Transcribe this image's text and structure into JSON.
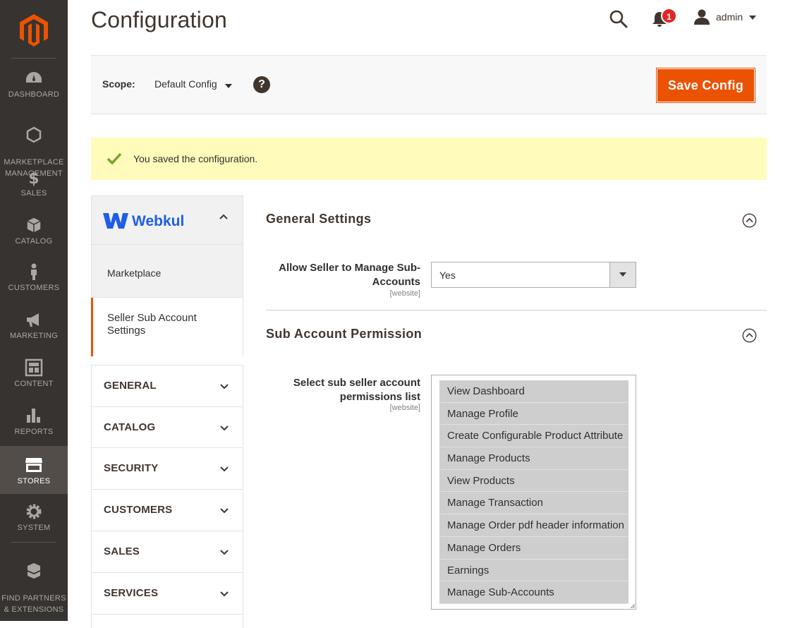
{
  "nav": {
    "items": [
      {
        "label": "DASHBOARD",
        "icon": "dashboard-icon"
      },
      {
        "label": "MARKETPLACE\nMANAGEMENT",
        "icon": "hexagon-icon"
      },
      {
        "label": "SALES",
        "icon": "dollar-icon"
      },
      {
        "label": "CATALOG",
        "icon": "box-icon"
      },
      {
        "label": "CUSTOMERS",
        "icon": "person-icon"
      },
      {
        "label": "MARKETING",
        "icon": "megaphone-icon"
      },
      {
        "label": "CONTENT",
        "icon": "layout-icon"
      },
      {
        "label": "REPORTS",
        "icon": "bar-chart-icon"
      },
      {
        "label": "STORES",
        "icon": "storefront-icon",
        "active": true
      },
      {
        "label": "SYSTEM",
        "icon": "gear-icon"
      },
      {
        "label": "FIND PARTNERS\n& EXTENSIONS",
        "icon": "boxes-icon"
      }
    ]
  },
  "header": {
    "title": "Configuration",
    "notification_count": "1",
    "username": "admin"
  },
  "scope": {
    "label": "Scope:",
    "value": "Default Config",
    "help": "?",
    "save_label": "Save Config"
  },
  "message": {
    "text": "You saved the configuration."
  },
  "tabs": {
    "brand": "Webkul",
    "sub_items": [
      "Marketplace",
      "Seller Sub Account Settings"
    ],
    "groups": [
      "GENERAL",
      "CATALOG",
      "SECURITY",
      "CUSTOMERS",
      "SALES",
      "SERVICES"
    ]
  },
  "general_settings": {
    "title": "General Settings",
    "field_label": "Allow Seller to Manage Sub-Accounts",
    "scope_tag": "[website]",
    "value": "Yes"
  },
  "permissions": {
    "title": "Sub Account Permission",
    "field_label": "Select sub seller account permissions list",
    "scope_tag": "[website]",
    "options": [
      "View Dashboard",
      "Manage Profile",
      "Create Configurable Product Attribute",
      "Manage Products",
      "View Products",
      "Manage Transaction",
      "Manage Order pdf header information",
      "Manage Orders",
      "Earnings",
      "Manage Sub-Accounts"
    ]
  },
  "colors": {
    "nav_bg": "#373330",
    "accent": "#eb5202",
    "message_bg": "#fffbbb",
    "brand_blue": "#1d5ee8"
  }
}
